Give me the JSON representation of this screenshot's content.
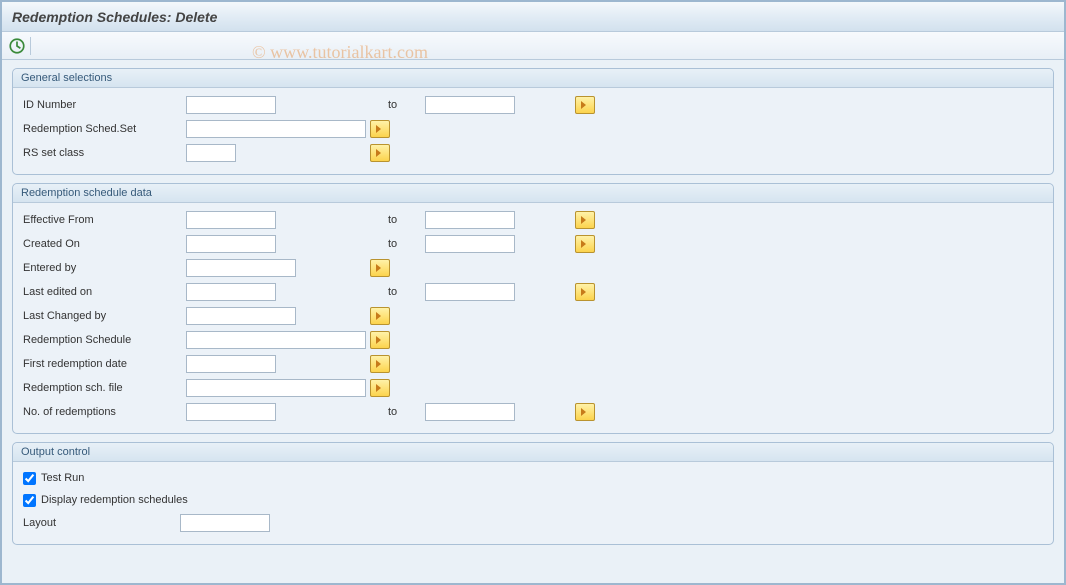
{
  "title": "Redemption Schedules: Delete",
  "watermark": "© www.tutorialkart.com",
  "labels": {
    "to": "to"
  },
  "group1": {
    "title": "General selections",
    "idNumber": {
      "label": "ID Number",
      "from": "",
      "to": ""
    },
    "redSchedSet": {
      "label": "Redemption Sched.Set",
      "value": ""
    },
    "rsSetClass": {
      "label": "RS set class",
      "value": ""
    }
  },
  "group2": {
    "title": "Redemption schedule data",
    "effectiveFrom": {
      "label": "Effective From",
      "from": "",
      "to": ""
    },
    "createdOn": {
      "label": "Created On",
      "from": "",
      "to": ""
    },
    "enteredBy": {
      "label": "Entered by",
      "value": ""
    },
    "lastEditedOn": {
      "label": "Last edited on",
      "from": "",
      "to": ""
    },
    "lastChangedBy": {
      "label": "Last Changed by",
      "value": ""
    },
    "redemptionSchedule": {
      "label": "Redemption Schedule",
      "value": ""
    },
    "firstRedemptionDate": {
      "label": "First redemption date",
      "value": ""
    },
    "redemptionSchFile": {
      "label": "Redemption sch. file",
      "value": ""
    },
    "noOfRedemptions": {
      "label": "No. of redemptions",
      "from": "",
      "to": ""
    }
  },
  "group3": {
    "title": "Output control",
    "testRun": {
      "label": "Test Run",
      "checked": true
    },
    "displayRedemption": {
      "label": "Display redemption schedules",
      "checked": true
    },
    "layout": {
      "label": "Layout",
      "value": ""
    }
  }
}
